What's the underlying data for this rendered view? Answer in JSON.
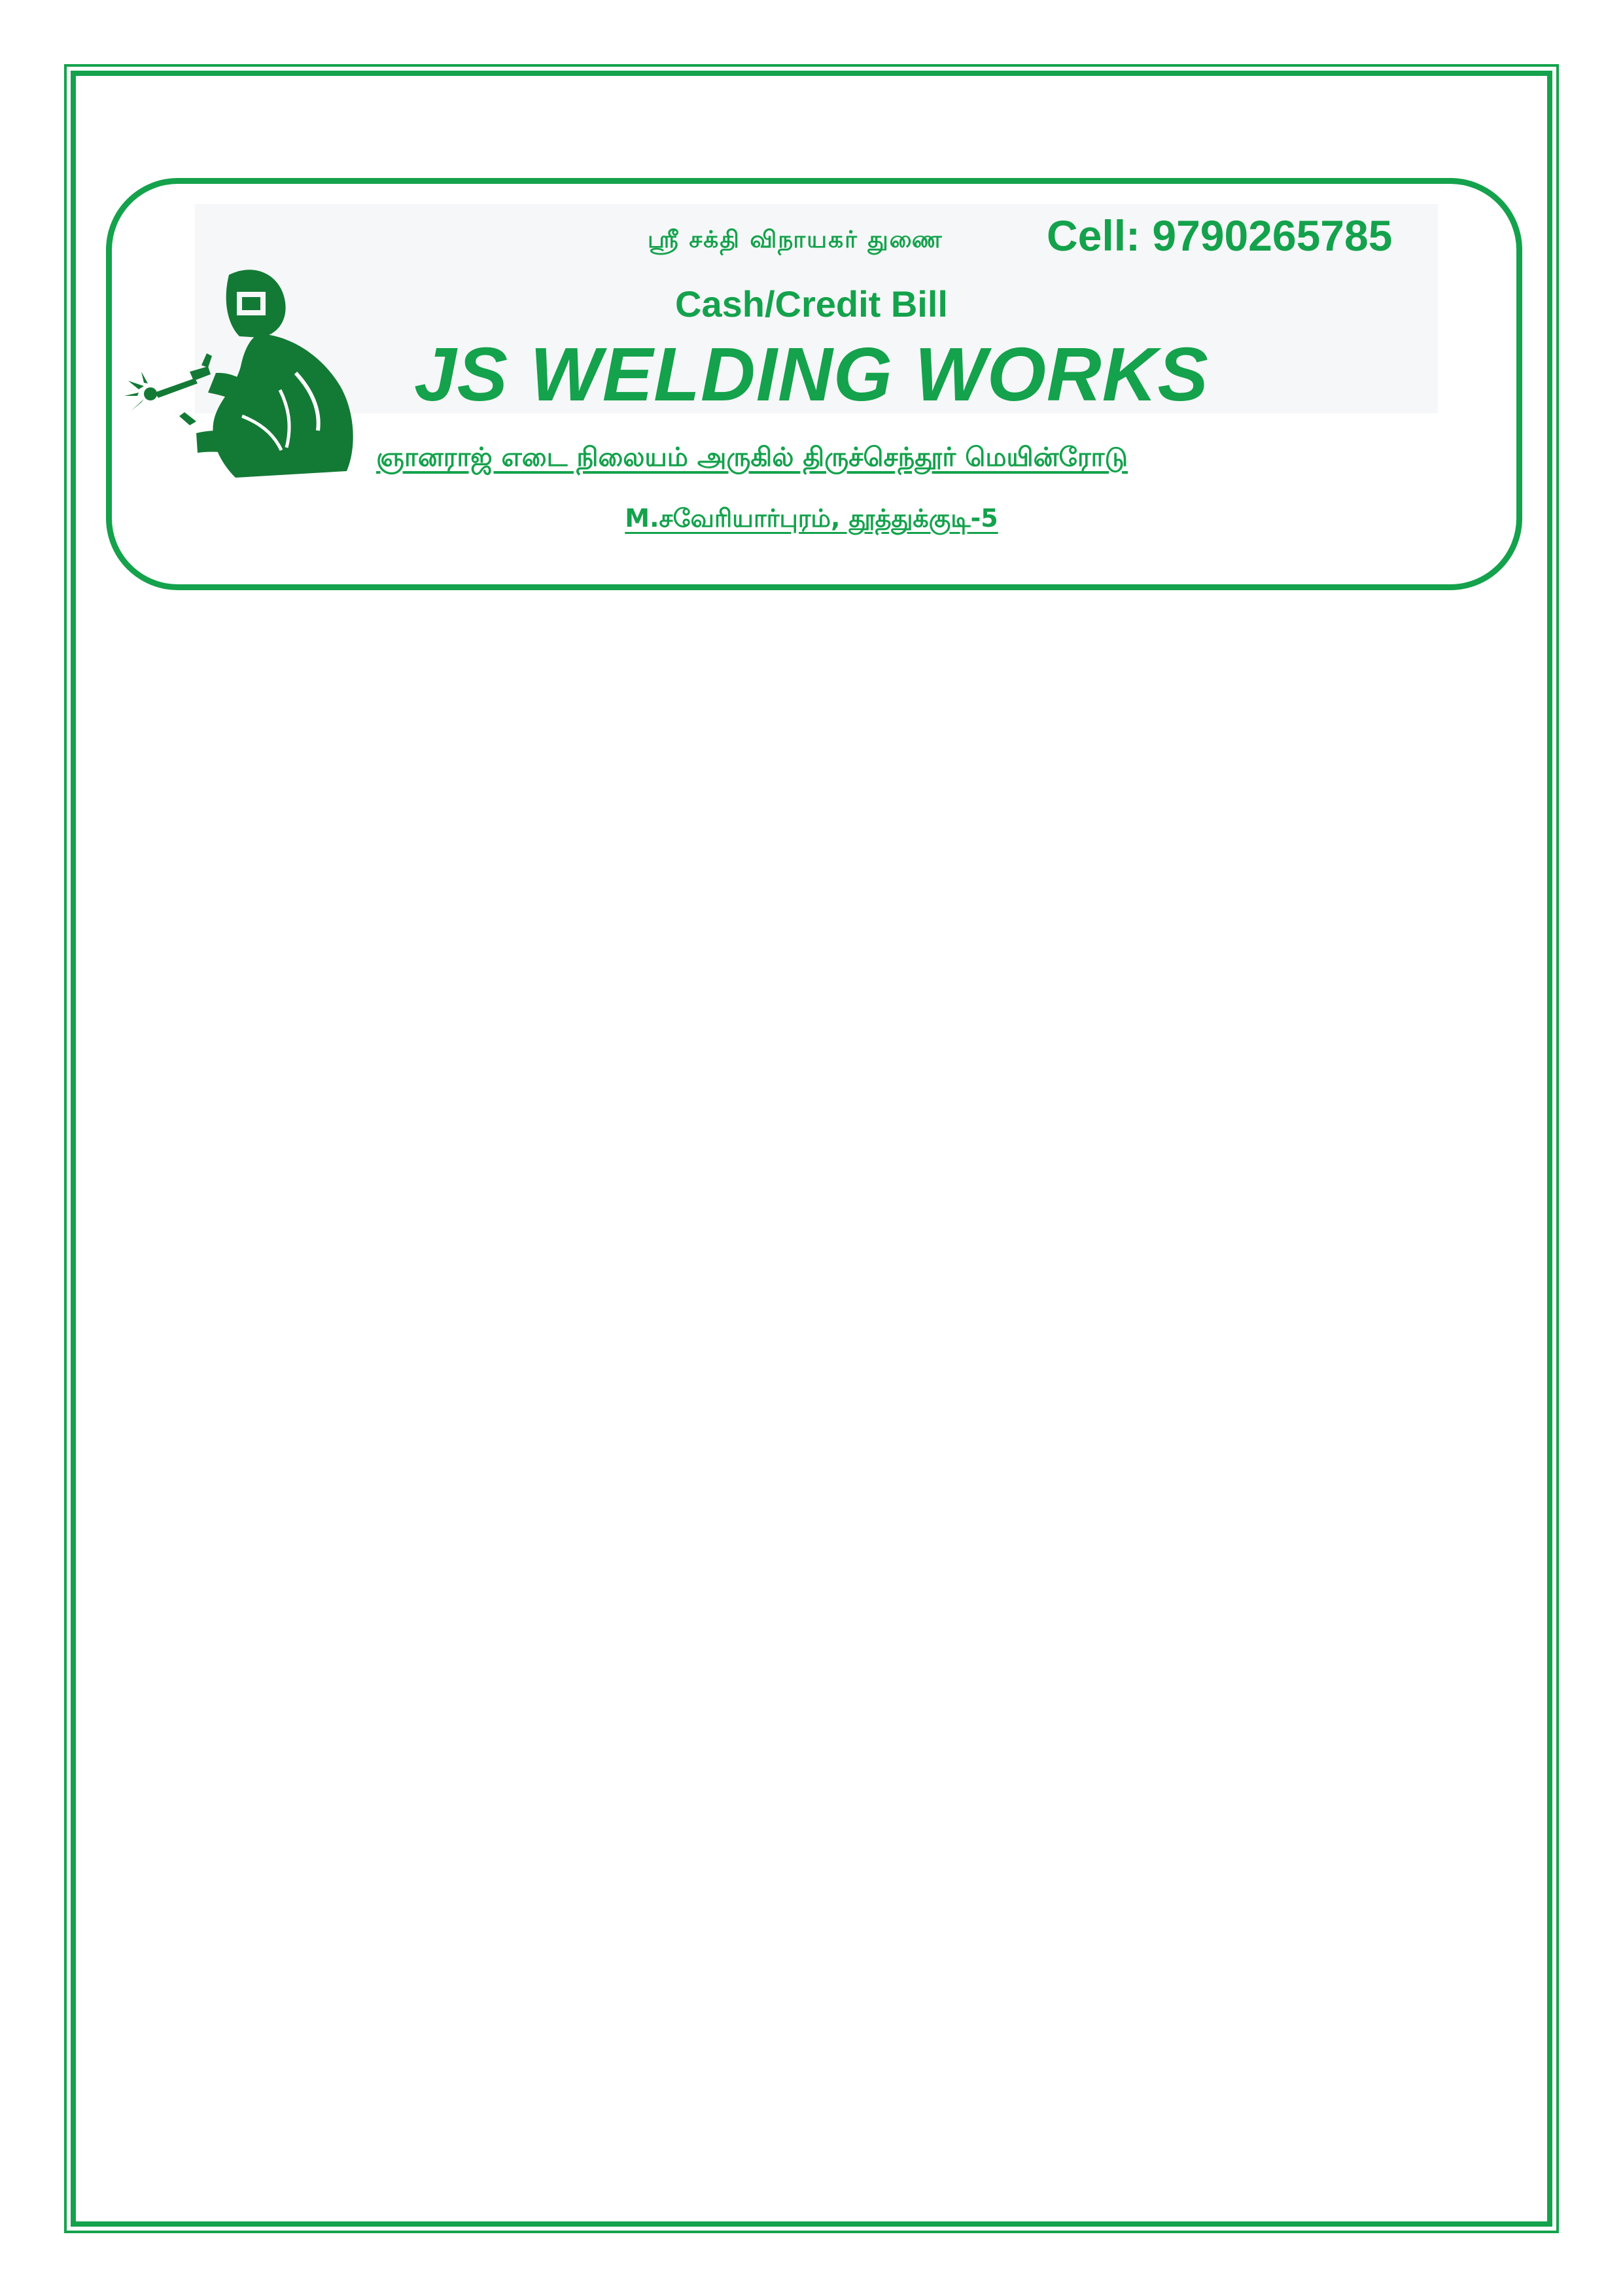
{
  "header": {
    "blessing": "ஸ்ரீ சக்தி விநாயகர் துணை",
    "cell": "Cell: 9790265785",
    "bill_type": "Cash/Credit Bill",
    "company_name": "JS WELDING WORKS",
    "address_line1": " ஞானராஜ் எடை நிலையம் அருகில் திருச்செந்தூர் மெயின்ரோடு",
    "address_line2": "M.சவேரியார்புரம், தூத்துக்குடி-5",
    "logo": "welder-icon"
  },
  "colors": {
    "accent": "#14a24c",
    "logo": "#137a35",
    "band": "#f6f7f8"
  }
}
